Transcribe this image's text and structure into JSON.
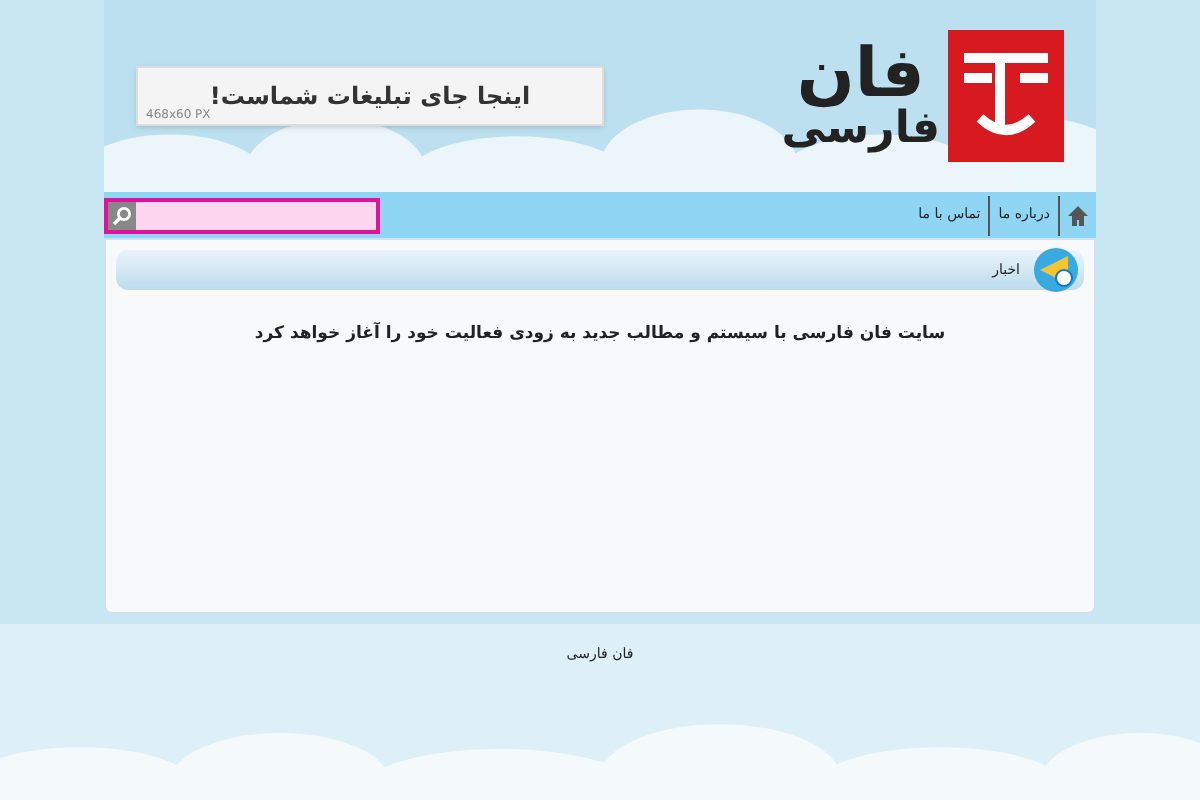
{
  "header": {
    "logo": {
      "title": "فان",
      "subtitle": "فارسی"
    },
    "ad_banner": {
      "text": "اینجا جای تبلیغات شماست!",
      "size": "468x60 PX"
    }
  },
  "nav": {
    "items": [
      {
        "label": "درباره ما"
      },
      {
        "label": "تماس با ما"
      }
    ]
  },
  "news": {
    "title": "اخبار",
    "message": "سایت فان فارسی با سیستم و مطالب جدید به زودی فعالیت خود را آغاز خواهد کرد"
  },
  "footer": {
    "text": "فان فارسی"
  }
}
